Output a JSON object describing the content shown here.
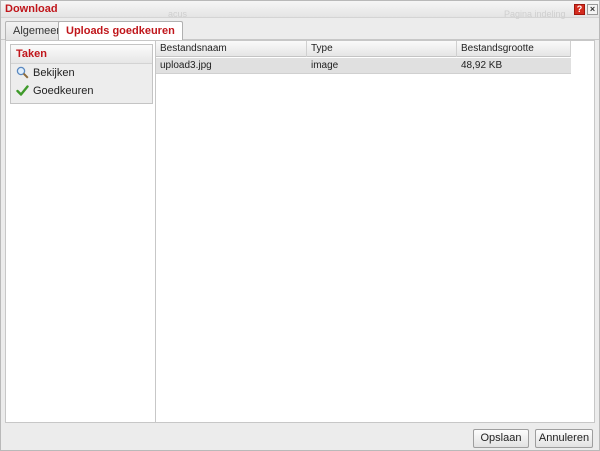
{
  "window": {
    "title": "Download",
    "ghost_left": "acus",
    "ghost_right": "Pagina indeling",
    "help_label": "?",
    "close_label": "×"
  },
  "tabs": [
    {
      "label": "Algemeen",
      "active": false
    },
    {
      "label": "Uploads goedkeuren",
      "active": true
    }
  ],
  "tasks": {
    "header": "Taken",
    "items": [
      {
        "label": "Bekijken",
        "icon": "magnifier-icon"
      },
      {
        "label": "Goedkeuren",
        "icon": "checkmark-icon"
      }
    ]
  },
  "table": {
    "columns": [
      "Bestandsnaam",
      "Type",
      "Bestandsgrootte"
    ],
    "rows": [
      {
        "name": "upload3.jpg",
        "type": "image",
        "size": "48,92 KB"
      }
    ]
  },
  "footer": {
    "save_label": "Opslaan",
    "cancel_label": "Annuleren"
  },
  "colors": {
    "accent": "#c0161b",
    "selected_row": "#e0e0e0",
    "help_button": "#d42b1e"
  }
}
